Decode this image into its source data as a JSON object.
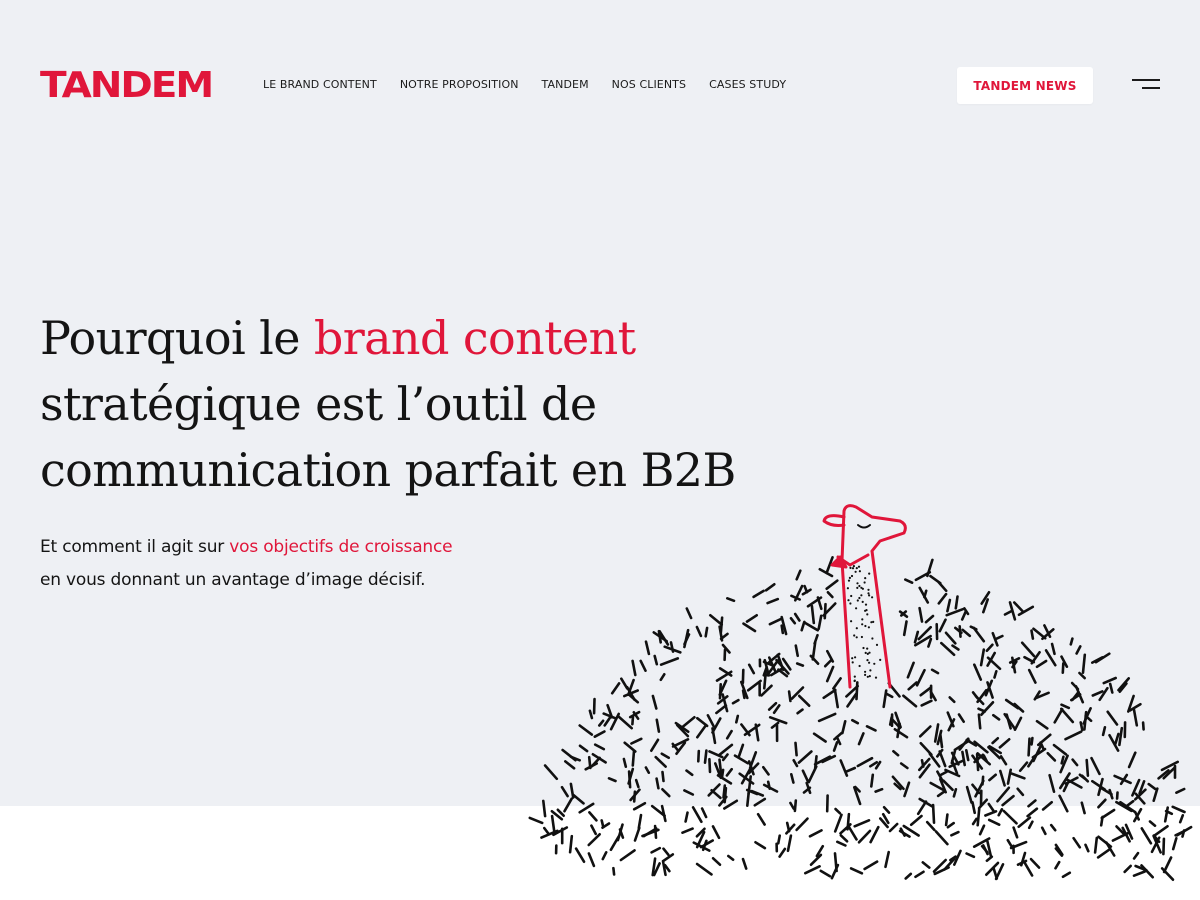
{
  "header": {
    "logo_text": "TANDEM",
    "nav": [
      {
        "label": "LE BRAND CONTENT"
      },
      {
        "label": "NOTRE PROPOSITION"
      },
      {
        "label": "TANDEM"
      },
      {
        "label": "NOS CLIENTS"
      },
      {
        "label": "CASES STUDY"
      }
    ],
    "news_button": "TANDEM NEWS",
    "menu_icon": "hamburger-menu-icon"
  },
  "hero": {
    "headline": {
      "part1": "Pourquoi le ",
      "accent": "brand content",
      "part2": "stratégique est l’outil de",
      "part3": "communication parfait en B2B"
    },
    "subline": {
      "part1": "Et comment il agit sur ",
      "accent": "vos objectifs de croissance",
      "part2": "en vous donnant un avantage d’image décisif."
    },
    "illustration": "llama-in-grass-illustration"
  },
  "colors": {
    "brand_red": "#e0163a",
    "hero_background": "#eef0f4",
    "text": "#141414",
    "page_background": "#ffffff"
  }
}
